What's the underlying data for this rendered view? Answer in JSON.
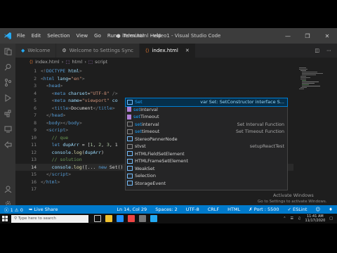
{
  "window": {
    "title": "● index.html - video1 - Visual Studio Code",
    "menu": [
      "File",
      "Edit",
      "Selection",
      "View",
      "Go",
      "Run",
      "Terminal",
      "Help"
    ]
  },
  "tabs": [
    {
      "label": "Welcome",
      "icon": "vscode-icon",
      "active": false
    },
    {
      "label": "Welcome to Settings Sync",
      "icon": "settings-icon",
      "active": false
    },
    {
      "label": "index.html",
      "icon": "html-file-icon",
      "active": true
    }
  ],
  "breadcrumb": [
    "index.html",
    "html",
    "script"
  ],
  "editor": {
    "current_line": 14,
    "lines": [
      {
        "n": "1",
        "tokens": [
          [
            "tg",
            "<!"
          ],
          [
            "tn",
            "DOCTYPE"
          ],
          [
            "an",
            " html"
          ],
          [
            "tg",
            ">"
          ]
        ]
      },
      {
        "n": "2",
        "tokens": [
          [
            "tg",
            "<"
          ],
          [
            "tn",
            "html"
          ],
          [
            "an",
            " lang"
          ],
          [
            "tx",
            "="
          ],
          [
            "av",
            "\"en\""
          ],
          [
            "tg",
            ">"
          ]
        ]
      },
      {
        "n": "3",
        "tokens": [
          [
            "tx",
            "  "
          ],
          [
            "tg",
            "<"
          ],
          [
            "tn",
            "head"
          ],
          [
            "tg",
            ">"
          ]
        ]
      },
      {
        "n": "4",
        "tokens": [
          [
            "tx",
            "    "
          ],
          [
            "tg",
            "<"
          ],
          [
            "tn",
            "meta"
          ],
          [
            "an",
            " charset"
          ],
          [
            "tx",
            "="
          ],
          [
            "av",
            "\"UTF-8\""
          ],
          [
            "tx",
            " "
          ],
          [
            "tg",
            "/>"
          ]
        ]
      },
      {
        "n": "5",
        "tokens": [
          [
            "tx",
            "    "
          ],
          [
            "tg",
            "<"
          ],
          [
            "tn",
            "meta"
          ],
          [
            "an",
            " name"
          ],
          [
            "tx",
            "="
          ],
          [
            "av",
            "\"viewport\""
          ],
          [
            "an",
            " co"
          ]
        ]
      },
      {
        "n": "6",
        "tokens": [
          [
            "tx",
            "    "
          ],
          [
            "tg",
            "<"
          ],
          [
            "tn",
            "title"
          ],
          [
            "tg",
            ">"
          ],
          [
            "tx",
            "Document"
          ],
          [
            "tg",
            "</"
          ],
          [
            "tn",
            "title"
          ],
          [
            "tg",
            ">"
          ]
        ]
      },
      {
        "n": "7",
        "tokens": [
          [
            "tx",
            "  "
          ],
          [
            "tg",
            "</"
          ],
          [
            "tn",
            "head"
          ],
          [
            "tg",
            ">"
          ]
        ]
      },
      {
        "n": "8",
        "tokens": [
          [
            "tx",
            "  "
          ],
          [
            "tg",
            "<"
          ],
          [
            "tn",
            "body"
          ],
          [
            "tg",
            "></"
          ],
          [
            "tn",
            "body"
          ],
          [
            "tg",
            ">"
          ]
        ]
      },
      {
        "n": "9",
        "tokens": [
          [
            "tx",
            "  "
          ],
          [
            "tg",
            "<"
          ],
          [
            "tn",
            "script"
          ],
          [
            "tg",
            ">"
          ]
        ]
      },
      {
        "n": "10",
        "tokens": [
          [
            "tx",
            "    "
          ],
          [
            "cm",
            "// que"
          ]
        ]
      },
      {
        "n": "11",
        "tokens": [
          [
            "tx",
            "    "
          ],
          [
            "kw",
            "let"
          ],
          [
            "an",
            " dupArr"
          ],
          [
            "tx",
            " = ["
          ],
          [
            "nm",
            "1"
          ],
          [
            "tx",
            ", "
          ],
          [
            "nm",
            "2"
          ],
          [
            "tx",
            ", "
          ],
          [
            "nm",
            "3"
          ],
          [
            "tx",
            ", 1"
          ]
        ]
      },
      {
        "n": "12",
        "tokens": [
          [
            "tx",
            "    "
          ],
          [
            "an",
            "console"
          ],
          [
            "tx",
            "."
          ],
          [
            "fn",
            "log"
          ],
          [
            "tx",
            "("
          ],
          [
            "an",
            "dupArr"
          ],
          [
            "tx",
            ")"
          ]
        ]
      },
      {
        "n": "13",
        "tokens": [
          [
            "tx",
            "    "
          ],
          [
            "cm",
            "// solution"
          ]
        ]
      },
      {
        "n": "14",
        "tokens": [
          [
            "tx",
            "    "
          ],
          [
            "an",
            "console"
          ],
          [
            "tx",
            "."
          ],
          [
            "fn",
            "log"
          ],
          [
            "tx",
            "([... "
          ],
          [
            "kw",
            "new"
          ],
          [
            "tx",
            " Set"
          ],
          [
            "tx",
            "()"
          ]
        ]
      },
      {
        "n": "15",
        "tokens": [
          [
            "tx",
            "  "
          ],
          [
            "tg",
            "</"
          ],
          [
            "tn",
            "script"
          ],
          [
            "tg",
            ">"
          ]
        ]
      },
      {
        "n": "16",
        "tokens": [
          [
            "tg",
            "</"
          ],
          [
            "tn",
            "html"
          ],
          [
            "tg",
            ">"
          ]
        ]
      },
      {
        "n": "17",
        "tokens": []
      }
    ]
  },
  "suggestions": [
    {
      "icon": "var",
      "hl": "Set",
      "rest": "",
      "detail": "var Set: SetConstructor interface S...",
      "selected": true
    },
    {
      "icon": "fn",
      "hl": "set",
      "rest": "Interval",
      "detail": "",
      "selected": false
    },
    {
      "icon": "fn",
      "hl": "set",
      "rest": "Timeout",
      "detail": "",
      "selected": false
    },
    {
      "icon": "wd",
      "hl": "set",
      "rest": "interval",
      "detail": "Set Interval Function",
      "selected": false
    },
    {
      "icon": "wd",
      "hl": "set",
      "rest": "timeout",
      "detail": "Set Timeout Function",
      "selected": false
    },
    {
      "icon": "var",
      "hl": "",
      "rest": "StereoPannerNode",
      "detail": "",
      "selected": false
    },
    {
      "icon": "wd",
      "hl": "",
      "rest": "stvst",
      "detail": "setupReactTest",
      "selected": false
    },
    {
      "icon": "var",
      "hl": "",
      "rest": "HTMLFieldSetElement",
      "detail": "",
      "selected": false
    },
    {
      "icon": "var",
      "hl": "",
      "rest": "HTMLFrameSetElement",
      "detail": "",
      "selected": false
    },
    {
      "icon": "var",
      "hl": "",
      "rest": "WeakSet",
      "detail": "",
      "selected": false
    },
    {
      "icon": "var",
      "hl": "",
      "rest": "Selection",
      "detail": "",
      "selected": false
    },
    {
      "icon": "var",
      "hl": "",
      "rest": "StorageEvent",
      "detail": "",
      "selected": false
    }
  ],
  "watermark": {
    "line1": "Activate Windows",
    "line2": "Go to Settings to activate Windows."
  },
  "statusbar": {
    "errors": "1",
    "warnings": "0",
    "live_share": "Live Share",
    "position": "Ln 14, Col 29",
    "spaces": "Spaces: 2",
    "encoding": "UTF-8",
    "eol": "CRLF",
    "language": "HTML",
    "port": "Port : 5500",
    "eslint": "ESLint"
  },
  "taskbar": {
    "search_placeholder": "Type here to search",
    "time": "11:41 AM",
    "date": "11/17/2020"
  },
  "colors": {
    "accent": "#007acc",
    "suggest_highlight": "#18a3ff"
  }
}
